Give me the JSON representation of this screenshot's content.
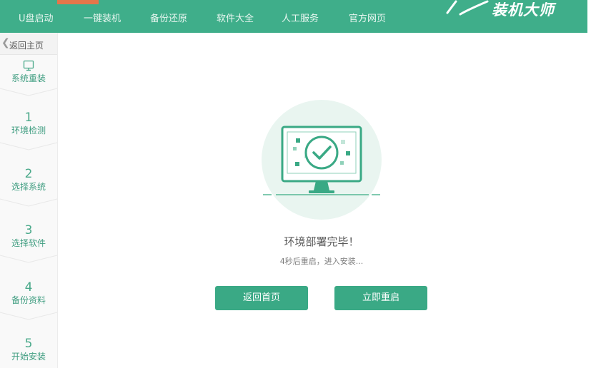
{
  "nav": {
    "items": [
      "U盘启动",
      "一键装机",
      "备份还原",
      "软件大全",
      "人工服务",
      "官方网页"
    ]
  },
  "logo": {
    "text": "装机大师"
  },
  "sidebar": {
    "back_label": "返回主页",
    "header_label": "系统重装",
    "steps": [
      {
        "num": "1",
        "label": "环境检测"
      },
      {
        "num": "2",
        "label": "选择系统"
      },
      {
        "num": "3",
        "label": "选择软件"
      },
      {
        "num": "4",
        "label": "备份资料"
      },
      {
        "num": "5",
        "label": "开始安装"
      }
    ]
  },
  "main": {
    "status_title": "环境部署完毕！",
    "status_subtitle": "4秒后重启，进入安装...",
    "home_button": "返回首页",
    "restart_button": "立即重启"
  },
  "colors": {
    "brand": "#3fae8a",
    "button": "#3aa985",
    "accent": "#e5764a"
  },
  "icons": [
    "monitor-icon",
    "check-circle-icon",
    "chevron-left-icon",
    "logo-swoosh-icon"
  ]
}
